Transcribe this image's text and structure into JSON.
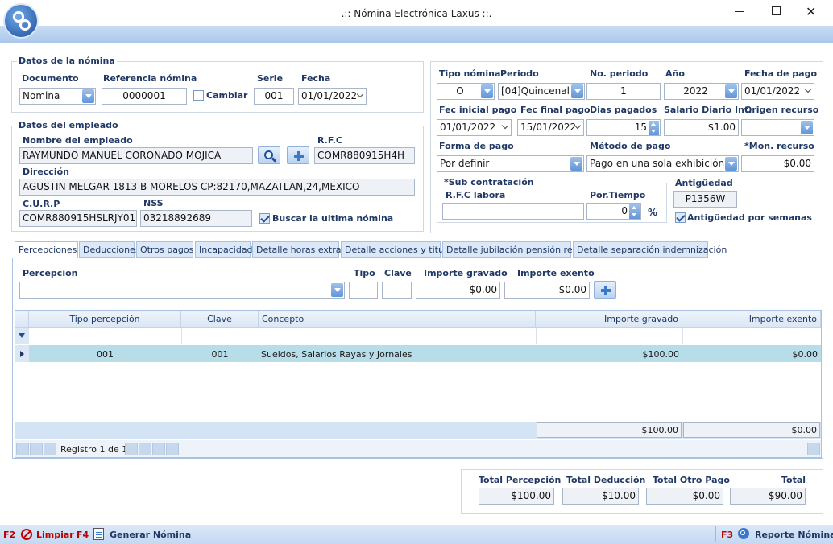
{
  "window": {
    "title": ".:: Nómina Electrónica Laxus ::."
  },
  "colors": {
    "accent": "#5f95d8",
    "label": "#1f3864",
    "key": "#c00000",
    "row_selected": "#b7dde8"
  },
  "nomina": {
    "group_title": "Datos de la nómina",
    "documento_label": "Documento",
    "documento_value": "Nomina",
    "referencia_label": "Referencia nómina",
    "referencia_value": "0000001",
    "cambiar_label": "Cambiar",
    "serie_label": "Serie",
    "serie_value": "001",
    "fecha_label": "Fecha",
    "fecha_value": "01/01/2022"
  },
  "empleado": {
    "group_title": "Datos del empleado",
    "nombre_label": "Nombre del empleado",
    "nombre_value": "RAYMUNDO MANUEL CORONADO MOJICA",
    "rfc_label": "R.F.C",
    "rfc_value": "COMR880915H4H",
    "direccion_label": "Dirección",
    "direccion_value": "AGUSTIN MELGAR 1813 B MORELOS CP:82170,MAZATLAN,24,MEXICO",
    "curp_label": "C.U.R.P",
    "curp_value": "COMR880915HSLRJY01",
    "nss_label": "NSS",
    "nss_value": "03218892689",
    "buscar_label": "Buscar la ultima nómina"
  },
  "periodo": {
    "tipo_label": "Tipo nómina",
    "tipo_value": "O",
    "periodo_label": "Periodo",
    "periodo_value": "[04]Quincenal",
    "no_periodo_label": "No. periodo",
    "no_periodo_value": "1",
    "anio_label": "Año",
    "anio_value": "2022",
    "fecha_pago_label": "Fecha de pago",
    "fecha_pago_value": "01/01/2022",
    "fec_inicial_label": "Fec inicial pago",
    "fec_inicial_value": "01/01/2022",
    "fec_final_label": "Fec final pago",
    "fec_final_value": "15/01/2022",
    "dias_label": "Dias pagados",
    "dias_value": "15",
    "salario_label": "Salario Diario Int.",
    "salario_value": "$1.00",
    "origen_label": "Origen recurso",
    "origen_value": "",
    "forma_label": "Forma de pago",
    "forma_value": "Por definir",
    "metodo_label": "Método de pago",
    "metodo_value": "Pago en una sola exhibición",
    "mon_label": "*Mon. recurso",
    "mon_value": "$0.00",
    "sub_title": "*Sub contratación",
    "rfc_labora_label": "R.F.C labora",
    "rfc_labora_value": "",
    "por_tiempo_label": "Por.Tiempo",
    "por_tiempo_value": "0",
    "pct": "%",
    "antig_label": "Antigüedad",
    "antig_value": "P1356W",
    "antig_semanas_label": "Antigüedad por semanas"
  },
  "tabs": [
    "Percepciones",
    "Deducciones",
    "Otros pagos",
    "Incapacidad",
    "Detalle horas extras",
    "Detalle acciones y titulo",
    "Detalle jubilación pensión retiro",
    "Detalle separación indemnización"
  ],
  "percepcion_form": {
    "percepcion_label": "Percepcion",
    "percepcion_value": "",
    "tipo_label": "Tipo",
    "tipo_value": "",
    "clave_label": "Clave",
    "clave_value": "",
    "gravado_label": "Importe gravado",
    "gravado_value": "$0.00",
    "exento_label": "Importe exento",
    "exento_value": "$0.00"
  },
  "grid": {
    "columns": [
      "Tipo percepción",
      "Clave",
      "Concepto",
      "Importe gravado",
      "Importe exento"
    ],
    "rows": [
      {
        "tipo": "001",
        "clave": "001",
        "concepto": "Sueldos, Salarios  Rayas y Jornales",
        "gravado": "$100.00",
        "exento": "$0.00"
      }
    ],
    "footer_gravado": "$100.00",
    "footer_exento": "$0.00",
    "nav_text": "Registro 1 de 1"
  },
  "totals": {
    "percepcion_label": "Total Percepción",
    "percepcion_value": "$100.00",
    "deduccion_label": "Total Deducción",
    "deduccion_value": "$10.00",
    "otro_label": "Total Otro Pago",
    "otro_value": "$0.00",
    "total_label": "Total",
    "total_value": "$90.00"
  },
  "footer": {
    "f2": "F2",
    "limpiar": "Limpiar",
    "f4": "F4",
    "generar": "Generar Nómina",
    "f3": "F3",
    "reporte": "Reporte Nómina"
  }
}
